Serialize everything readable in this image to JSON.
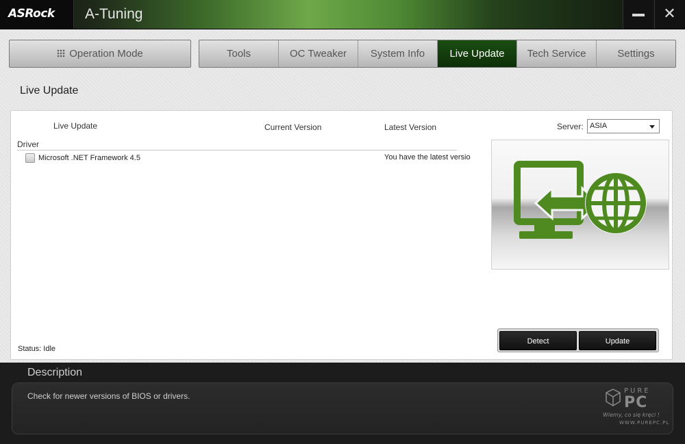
{
  "window": {
    "brand": "ASRock",
    "title": "A-Tuning",
    "minimize_label": "–",
    "close_label": "✕"
  },
  "nav": {
    "operation_mode": "Operation Mode",
    "tabs": [
      {
        "label": "Tools",
        "active": false
      },
      {
        "label": "OC Tweaker",
        "active": false
      },
      {
        "label": "System Info",
        "active": false
      },
      {
        "label": "Live Update",
        "active": true
      },
      {
        "label": "Tech Service",
        "active": false
      },
      {
        "label": "Settings",
        "active": false
      }
    ]
  },
  "page": {
    "title": "Live Update"
  },
  "table": {
    "columns": [
      "Live Update",
      "Current Version",
      "Latest Version"
    ],
    "group": "Driver",
    "rows": [
      {
        "name": "Microsoft .NET Framework 4.5",
        "current": "",
        "latest": "You have the latest versio",
        "checked": false
      }
    ]
  },
  "server": {
    "label": "Server:",
    "value": "ASIA"
  },
  "actions": {
    "detect": "Detect",
    "update": "Update"
  },
  "status": {
    "text": "Status: Idle"
  },
  "description": {
    "title": "Description",
    "text": "Check for newer versions of BIOS or drivers."
  },
  "watermark": {
    "brand_top": "PURE",
    "brand_bottom": "PC",
    "tagline": "Wiemy, co się kręci !",
    "url": "WWW.PUREPC.PL"
  },
  "colors": {
    "accent_green": "#1a4e12",
    "icon_green": "#4e8a1f",
    "desc_bg": "#1c1c1c"
  }
}
